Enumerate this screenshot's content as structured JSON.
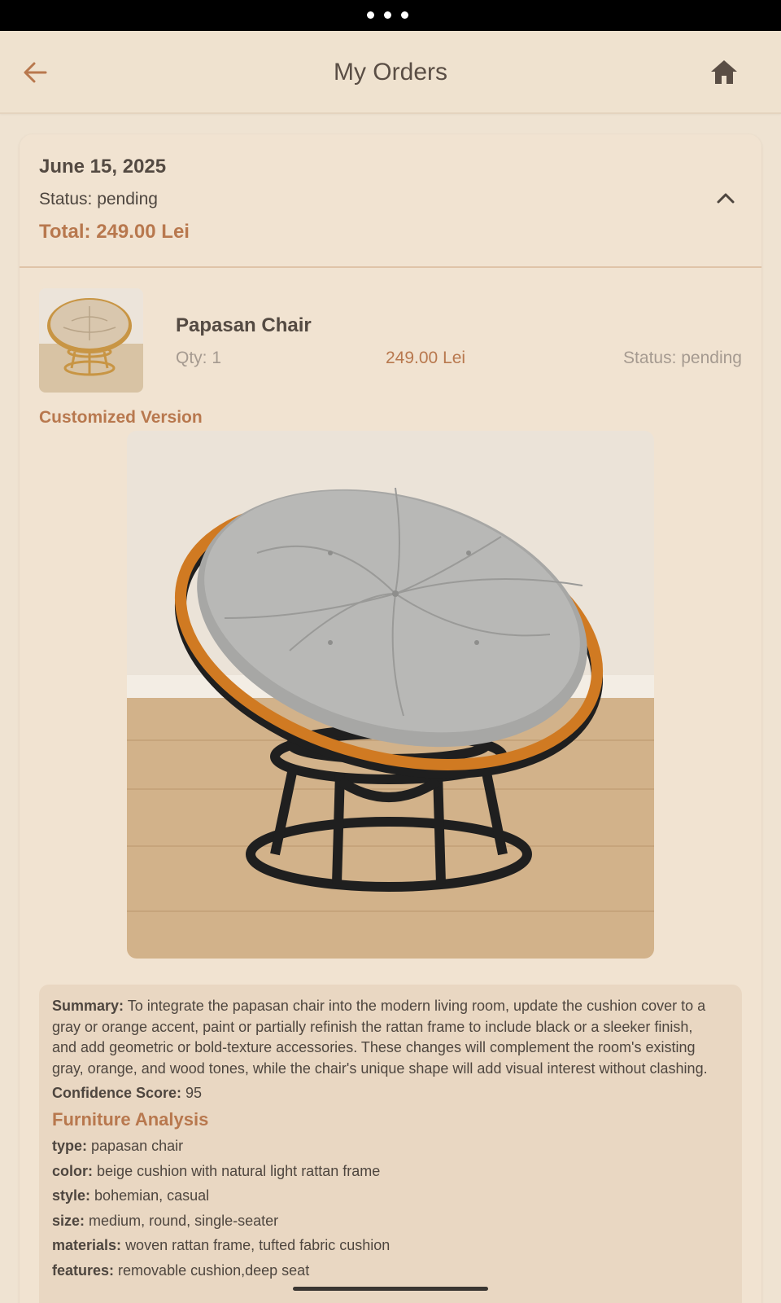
{
  "header": {
    "title": "My Orders",
    "back_icon": "arrow-left-icon",
    "home_icon": "home-icon"
  },
  "order": {
    "date": "June 15, 2025",
    "status": "Status: pending",
    "total": "Total: 249.00 Lei",
    "item": {
      "name": "Papasan Chair",
      "qty": "Qty: 1",
      "price": "249.00 Lei",
      "status": "Status: pending"
    },
    "custom_label": "Customized Version",
    "summary_label": "Summary:",
    "summary_text": "To integrate the papasan chair into the modern living room, update the cushion cover to a gray or orange accent, paint or partially refinish the rattan frame to include black or a sleeker finish, and add geometric or bold-texture accessories. These changes will complement the room's existing gray, orange, and wood tones, while the chair's unique shape will add visual interest without clashing.",
    "confidence_label": "Confidence Score:",
    "confidence_value": "95",
    "analysis_title": "Furniture Analysis",
    "analysis": [
      {
        "key": "type:",
        "value": "papasan chair"
      },
      {
        "key": "color:",
        "value": "beige cushion with natural light rattan frame"
      },
      {
        "key": "style:",
        "value": "bohemian, casual"
      },
      {
        "key": "size:",
        "value": "medium, round, single-seater"
      },
      {
        "key": "materials:",
        "value": "woven rattan frame, tufted fabric cushion"
      },
      {
        "key": "features:",
        "value": "removable cushion,deep seat"
      }
    ]
  },
  "colors": {
    "accent": "#b8784e",
    "background": "#efe3d2",
    "analysis_bg": "#e9d7c2"
  }
}
